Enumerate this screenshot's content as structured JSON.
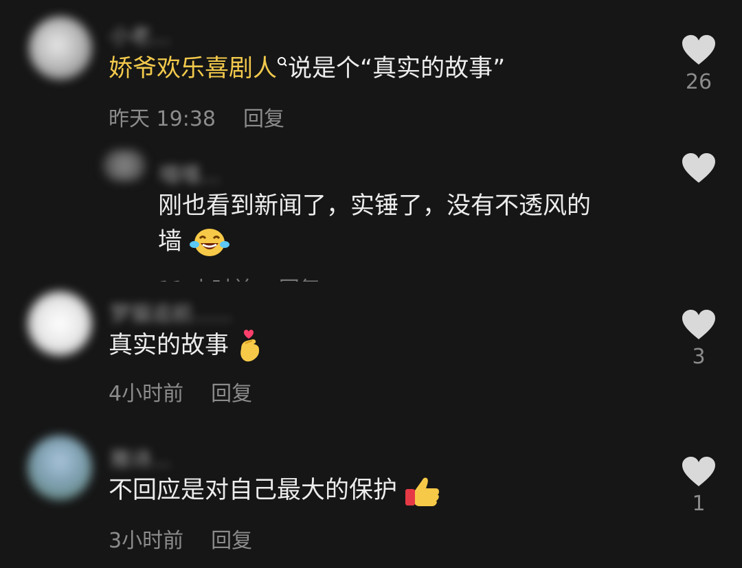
{
  "comments": [
    {
      "mention": "娇爷欢乐喜剧人",
      "text": "说是个“真实的故事”",
      "time": "昨天 19:38",
      "reply_label": "回复",
      "likes": "26",
      "avatar_icon": "avatar-blurred-icon"
    },
    {
      "text_line1": "刚也看到新闻了，实锤了，没有不透风的",
      "text_line2": "墙",
      "emoji": "laughing-crying-face-icon"
    },
    {
      "text": "真实的故事",
      "emoji": "finger-heart-icon",
      "time": "4小时前",
      "reply_label": "回复",
      "likes": "3",
      "avatar_icon": "avatar-blurred-icon"
    },
    {
      "text": "不回应是对自己最大的保护",
      "emoji": "thumbs-up-icon",
      "time": "3小时前",
      "reply_label": "回复",
      "likes": "1",
      "avatar_icon": "avatar-blurred-icon"
    }
  ],
  "colors": {
    "background": "#161616",
    "mention": "#f2c94c",
    "text": "#ececec",
    "meta": "#8c8c8c",
    "heart": "#d9d9d9"
  }
}
